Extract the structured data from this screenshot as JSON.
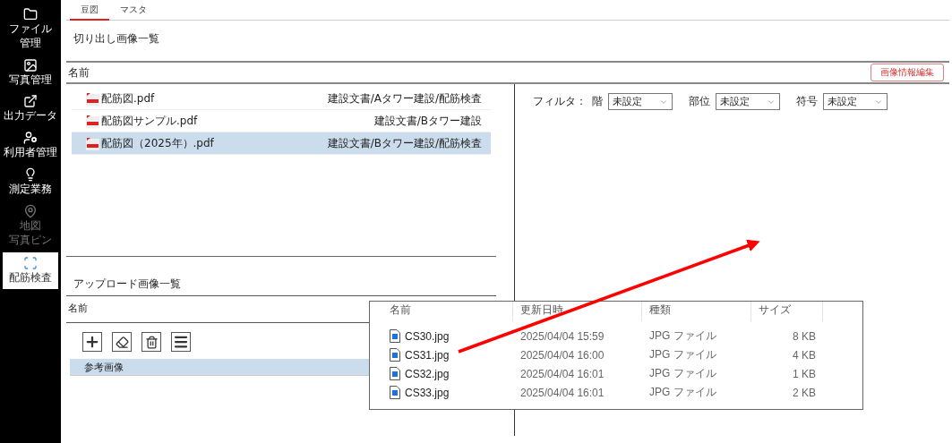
{
  "sidebar": {
    "items": [
      {
        "lines": [
          "ファイル",
          "管理"
        ],
        "selected": false,
        "disabled": false
      },
      {
        "lines": [
          "写真管理"
        ],
        "selected": false,
        "disabled": false
      },
      {
        "lines": [
          "出力データ"
        ],
        "selected": false,
        "disabled": false
      },
      {
        "lines": [
          "利用者管理"
        ],
        "selected": false,
        "disabled": false
      },
      {
        "lines": [
          "測定業務"
        ],
        "selected": false,
        "disabled": false
      },
      {
        "lines": [
          "地図",
          "写真ピン"
        ],
        "selected": false,
        "disabled": true
      },
      {
        "lines": [
          "配筋検査"
        ],
        "selected": true,
        "disabled": false
      }
    ]
  },
  "tabs": [
    {
      "label": "豆図",
      "selected": true
    },
    {
      "label": "マスタ",
      "selected": false
    }
  ],
  "section_title": "切り出し画像一覧",
  "header": {
    "column": "名前",
    "button": "画像情報編集"
  },
  "files": [
    {
      "name": "配筋図.pdf",
      "path": "建設文書/Aタワー建設/配筋検査",
      "selected": false
    },
    {
      "name": "配筋図サンプル.pdf",
      "path": "建設文書/Bタワー建設",
      "selected": false
    },
    {
      "name": "配筋図（2025年）.pdf",
      "path": "建設文書/Bタワー建設/配筋検査",
      "selected": true
    }
  ],
  "upload": {
    "title": "アップロード画像一覧",
    "column": "名前",
    "rows": [
      {
        "name": "参考画像",
        "selected": true
      }
    ]
  },
  "filter": {
    "label": "フィルタ：",
    "fields": [
      {
        "label": "階",
        "value": "未設定"
      },
      {
        "label": "部位",
        "value": "未設定"
      },
      {
        "label": "符号",
        "value": "未設定"
      }
    ]
  },
  "explorer": {
    "columns": [
      "名前",
      "更新日時",
      "種類",
      "サイズ"
    ],
    "rows": [
      {
        "name": "CS30.jpg",
        "date": "2025/04/04 15:59",
        "type": "JPG ファイル",
        "size": "8 KB"
      },
      {
        "name": "CS31.jpg",
        "date": "2025/04/04 16:00",
        "type": "JPG ファイル",
        "size": "4 KB"
      },
      {
        "name": "CS32.jpg",
        "date": "2025/04/04 16:01",
        "type": "JPG ファイル",
        "size": "1 KB"
      },
      {
        "name": "CS33.jpg",
        "date": "2025/04/04 16:01",
        "type": "JPG ファイル",
        "size": "2 KB"
      }
    ]
  }
}
